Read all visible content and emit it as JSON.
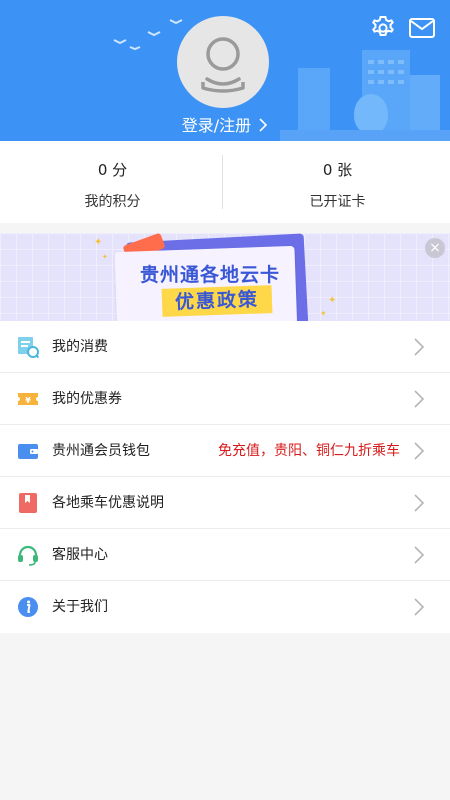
{
  "header": {
    "login_label": "登录/注册",
    "background_color": "#3d93f5",
    "icons": [
      "gear-icon",
      "mail-icon",
      "avatar-icon",
      "chevron-right-icon"
    ]
  },
  "stats": [
    {
      "value": "0 分",
      "label": "我的积分"
    },
    {
      "value": "0 张",
      "label": "已开证卡"
    }
  ],
  "banner": {
    "title_line1": "贵州通各地云卡",
    "title_line2": "优惠政策",
    "close_glyph": "×",
    "background_color": "#e5e2fb",
    "accent_color": "#3a58d6",
    "highlight_color": "#ffd84a"
  },
  "menu": {
    "items": [
      {
        "label": "我的消费",
        "icon": "consumption-receipt-icon",
        "promo": ""
      },
      {
        "label": "我的优惠券",
        "icon": "coupon-ticket-icon",
        "promo": ""
      },
      {
        "label": "贵州通会员钱包",
        "icon": "wallet-icon",
        "promo": "免充值，贵阳、铜仁九折乘车"
      },
      {
        "label": "各地乘车优惠说明",
        "icon": "bookmark-book-icon",
        "promo": ""
      },
      {
        "label": "客服中心",
        "icon": "headset-icon",
        "promo": ""
      },
      {
        "label": "关于我们",
        "icon": "info-icon",
        "promo": ""
      }
    ],
    "promo_color": "#d71a1a"
  }
}
